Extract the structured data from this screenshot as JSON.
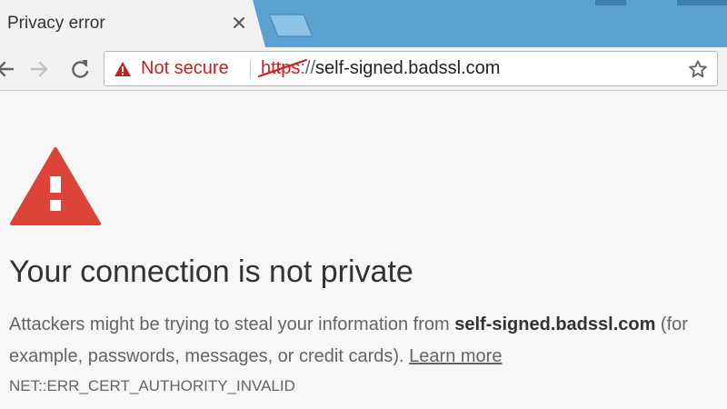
{
  "tab": {
    "title": "Privacy error"
  },
  "toolbar": {
    "security_label": "Not secure",
    "url_scheme": "https",
    "url_separator": "://",
    "url_host": "self-signed.badssl.com"
  },
  "interstitial": {
    "heading": "Your connection is not private",
    "explanation_prefix": "Attackers might be trying to steal your information from ",
    "explanation_host": "self-signed.badssl.com",
    "explanation_suffix": " (for example, passwords, messages, or credit cards). ",
    "learn_more_label": "Learn more",
    "error_code": "NET::ERR_CERT_AUTHORITY_INVALID"
  },
  "colors": {
    "tab_strip": "#5aa3d1",
    "warning_red": "#db4437",
    "not_secure_red": "#c5221f",
    "page_background": "#f7f7f7",
    "body_text": "#646464",
    "heading_text": "#333333"
  },
  "icons": {
    "tab_close": "close-icon",
    "back": "back-arrow-icon",
    "forward": "forward-arrow-icon",
    "reload": "reload-icon",
    "security": "warning-triangle-icon",
    "bookmark": "star-icon",
    "page_warning": "warning-triangle-icon"
  }
}
